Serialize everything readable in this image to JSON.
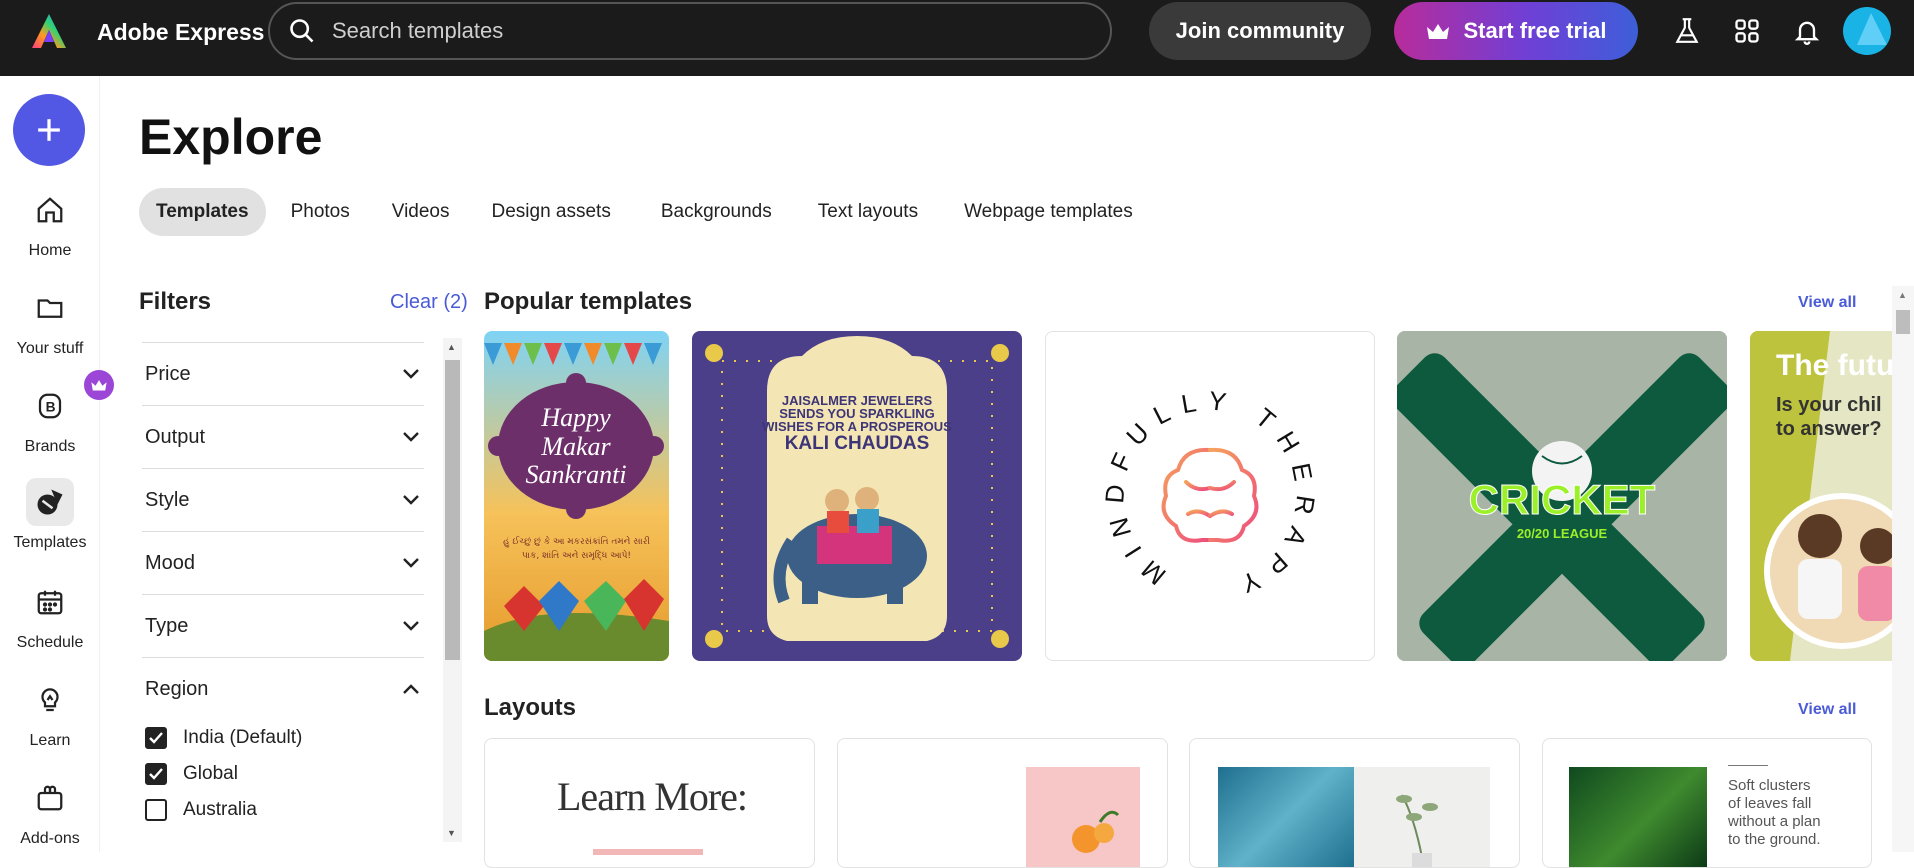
{
  "app": {
    "brand": "Adobe Express"
  },
  "search": {
    "placeholder": "Search templates"
  },
  "header": {
    "join_label": "Join community",
    "trial_label": "Start free trial"
  },
  "rail": {
    "items": [
      {
        "label": "Home",
        "icon": "home-icon"
      },
      {
        "label": "Your stuff",
        "icon": "folder-icon"
      },
      {
        "label": "Brands",
        "icon": "brand-icon"
      },
      {
        "label": "Templates",
        "icon": "templates-icon"
      },
      {
        "label": "Schedule",
        "icon": "calendar-icon"
      },
      {
        "label": "Learn",
        "icon": "lightbulb-icon"
      },
      {
        "label": "Add-ons",
        "icon": "addons-icon"
      }
    ]
  },
  "page": {
    "title": "Explore"
  },
  "tabs": [
    "Templates",
    "Photos",
    "Videos",
    "Design assets",
    "Backgrounds",
    "Text layouts",
    "Webpage templates"
  ],
  "filters": {
    "title": "Filters",
    "clear_label": "Clear (2)",
    "groups": [
      "Price",
      "Output",
      "Style",
      "Mood",
      "Type",
      "Region"
    ],
    "region_options": [
      {
        "label": "India (Default)",
        "checked": true
      },
      {
        "label": "Global",
        "checked": true
      },
      {
        "label": "Australia",
        "checked": false
      }
    ]
  },
  "sections": {
    "popular": {
      "title": "Popular templates",
      "view_all": "View all"
    },
    "layouts": {
      "title": "Layouts",
      "view_all": "View all"
    }
  },
  "templates": {
    "makar": {
      "line1": "Happy",
      "line2": "Makar",
      "line3": "Sankranti",
      "sub": "હું ઈચ્છું છું કે આ મકરસંક્રાંતિ તમને સારી પાક, શાંતિ અને સમૃદ્ધિ આપે!"
    },
    "kali": {
      "line1": "JAISALMER JEWELERS",
      "line2": "SENDS YOU SPARKLING",
      "line3": "WISHES FOR A PROSPEROUS",
      "line4": "KALI CHAUDAS"
    },
    "mindful": {
      "text": "MINDFULLY THERAPY"
    },
    "cricket": {
      "title": "CRICKET",
      "sub": "20/20 LEAGUE"
    },
    "future": {
      "title": "The future",
      "line1": "Is your chil",
      "line2": "to answer?"
    }
  },
  "layouts": {
    "learn": "Learn More:",
    "leaves": [
      "Soft clusters",
      "of leaves fall",
      "without a plan",
      "to the ground."
    ]
  },
  "colors": {
    "accent": "#4a5bd6",
    "create": "#5258e4",
    "topbar": "#1b1b1b"
  }
}
